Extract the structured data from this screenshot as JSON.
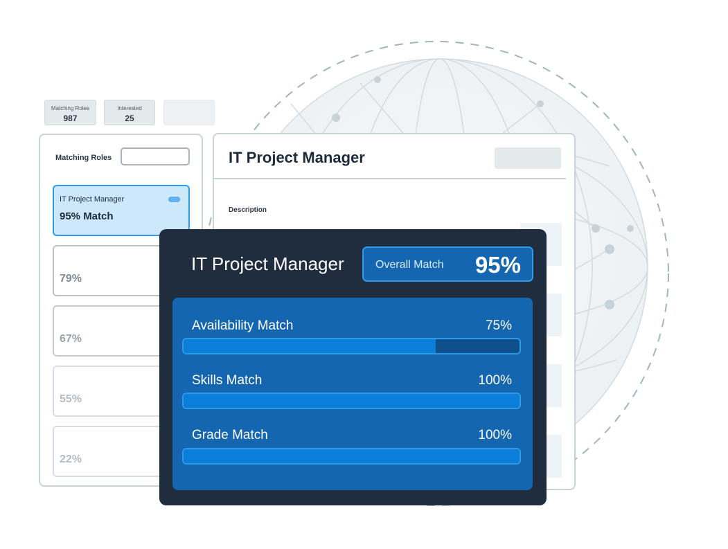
{
  "stats": {
    "matching_roles_label": "Matching Roles",
    "matching_roles_value": "987",
    "interested_label": "Interested",
    "interested_value": "25"
  },
  "roles_panel": {
    "title": "Matching Roles",
    "roles": [
      {
        "name": "IT Project Manager",
        "match": "95% Match",
        "active": true
      },
      {
        "name": "",
        "match": "79%"
      },
      {
        "name": "",
        "match": "67%"
      },
      {
        "name": "",
        "match": "55%"
      },
      {
        "name": "",
        "match": "22%"
      }
    ]
  },
  "detail": {
    "title": "IT Project Manager",
    "description_label": "Description"
  },
  "match_card": {
    "title": "IT Project Manager",
    "overall_label": "Overall Match",
    "overall_value": "95%",
    "metrics": [
      {
        "label": "Availability Match",
        "value": "75%",
        "fraction": 0.75
      },
      {
        "label": "Skills Match",
        "value": "100%",
        "fraction": 1.0
      },
      {
        "label": "Grade Match",
        "value": "100%",
        "fraction": 1.0
      }
    ]
  },
  "colors": {
    "accent": "#2f9ae6",
    "dark_card": "#1f2d3f",
    "metric_panel": "#1466b1",
    "active_role": "#cde7fb"
  }
}
